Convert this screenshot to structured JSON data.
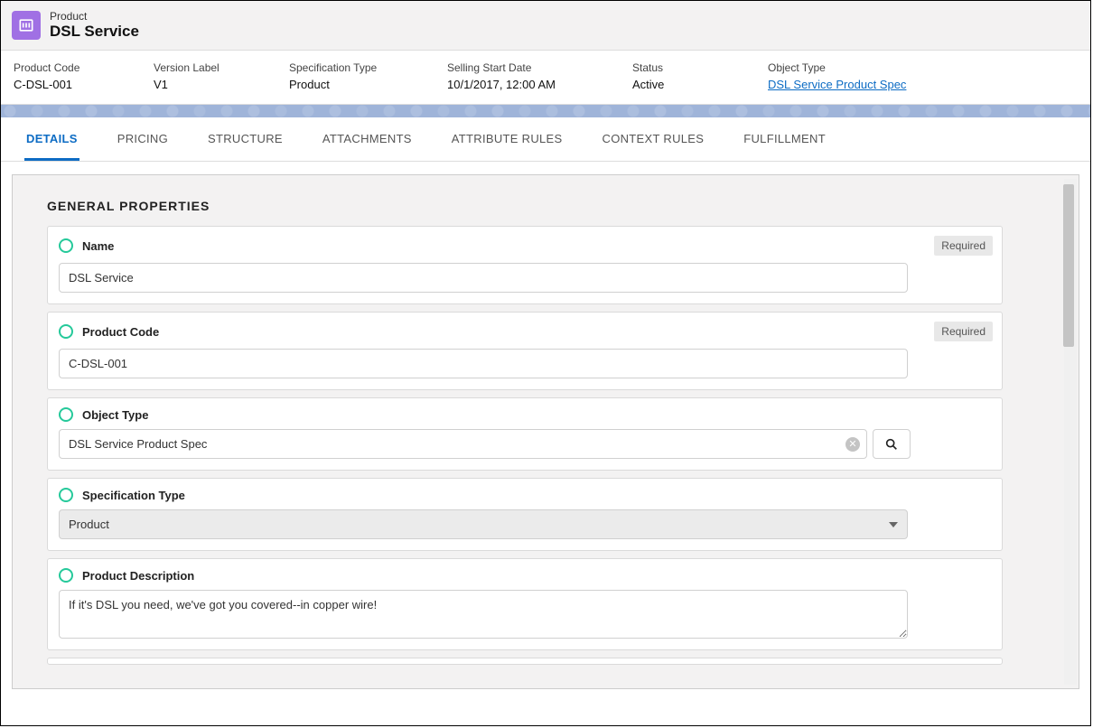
{
  "header": {
    "type_label": "Product",
    "title": "DSL Service"
  },
  "summary": [
    {
      "label": "Product Code",
      "value": "C-DSL-001",
      "link": false
    },
    {
      "label": "Version Label",
      "value": "V1",
      "link": false
    },
    {
      "label": "Specification Type",
      "value": "Product",
      "link": false
    },
    {
      "label": "Selling Start Date",
      "value": "10/1/2017, 12:00 AM",
      "link": false
    },
    {
      "label": "Status",
      "value": "Active",
      "link": false
    },
    {
      "label": "Object Type",
      "value": "DSL Service Product Spec",
      "link": true
    }
  ],
  "tabs": [
    "DETAILS",
    "PRICING",
    "STRUCTURE",
    "ATTACHMENTS",
    "ATTRIBUTE RULES",
    "CONTEXT RULES",
    "FULFILLMENT"
  ],
  "active_tab_index": 0,
  "section_title": "GENERAL PROPERTIES",
  "required_label": "Required",
  "fields": {
    "name": {
      "label": "Name",
      "value": "DSL Service",
      "required": true
    },
    "product_code": {
      "label": "Product Code",
      "value": "C-DSL-001",
      "required": true
    },
    "object_type": {
      "label": "Object Type",
      "value": "DSL Service Product Spec"
    },
    "spec_type": {
      "label": "Specification Type",
      "value": "Product"
    },
    "description": {
      "label": "Product Description",
      "value": "If it's DSL you need, we've got you covered--in copper wire!"
    }
  }
}
